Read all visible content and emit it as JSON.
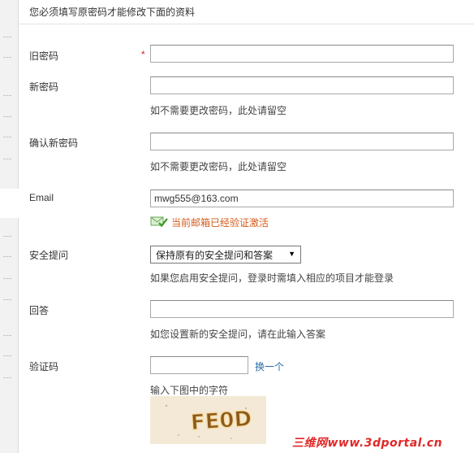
{
  "notice": "您必须填写原密码才能修改下面的资料",
  "fields": {
    "old_password": {
      "label": "旧密码",
      "required_mark": "*",
      "value": ""
    },
    "new_password": {
      "label": "新密码",
      "value": "",
      "hint": "如不需要更改密码，此处请留空"
    },
    "confirm_password": {
      "label": "确认新密码",
      "value": "",
      "hint": "如不需要更改密码，此处请留空"
    },
    "email": {
      "label": "Email",
      "value": "mwg555@163.com",
      "verified_text": "当前邮箱已经验证激活"
    },
    "security_question": {
      "label": "安全提问",
      "selected": "保持原有的安全提问和答案",
      "hint": "如果您启用安全提问，登录时需填入相应的项目才能登录"
    },
    "answer": {
      "label": "回答",
      "value": "",
      "hint": "如您设置新的安全提问，请在此输入答案"
    },
    "captcha": {
      "label": "验证码",
      "value": "",
      "refresh_link": "换一个",
      "hint": "输入下图中的字符",
      "image_text": "FE0D"
    }
  },
  "watermark": "三维网www.3dportal.cn",
  "colors": {
    "required": "#e02020",
    "verified": "#d65b1b",
    "link": "#2a6ea6"
  }
}
